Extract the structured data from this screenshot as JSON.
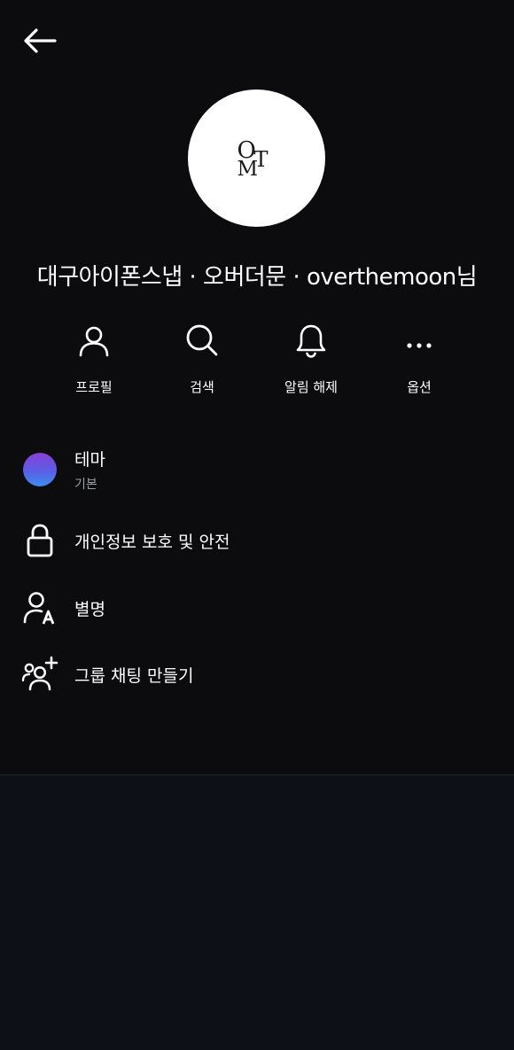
{
  "header": {
    "back_icon": "arrow-left-icon"
  },
  "profile": {
    "avatar_logo": [
      "O",
      "T",
      "M"
    ],
    "name": "대구아이폰스냅 · 오버더문 · overthemoon님"
  },
  "actions": [
    {
      "label": "프로필",
      "icon": "user-icon"
    },
    {
      "label": "검색",
      "icon": "search-icon"
    },
    {
      "label": "알림 해제",
      "icon": "bell-icon"
    },
    {
      "label": "옵션",
      "icon": "more-horizontal-icon"
    }
  ],
  "menu": {
    "theme": {
      "title": "테마",
      "subtitle": "기본",
      "swatch_colors": [
        "#8a3fd6",
        "#3c8ef0"
      ]
    },
    "privacy": {
      "title": "개인정보 보호 및 안전",
      "icon": "lock-icon"
    },
    "nickname": {
      "title": "별명",
      "icon": "user-a-icon"
    },
    "group_chat": {
      "title": "그룹 채팅 만들기",
      "icon": "group-add-icon"
    }
  },
  "colors": {
    "background_top": "#0c0c0e",
    "background_bottom": "#0d1016",
    "text": "#ffffff",
    "subtext": "#9aa0a8"
  }
}
